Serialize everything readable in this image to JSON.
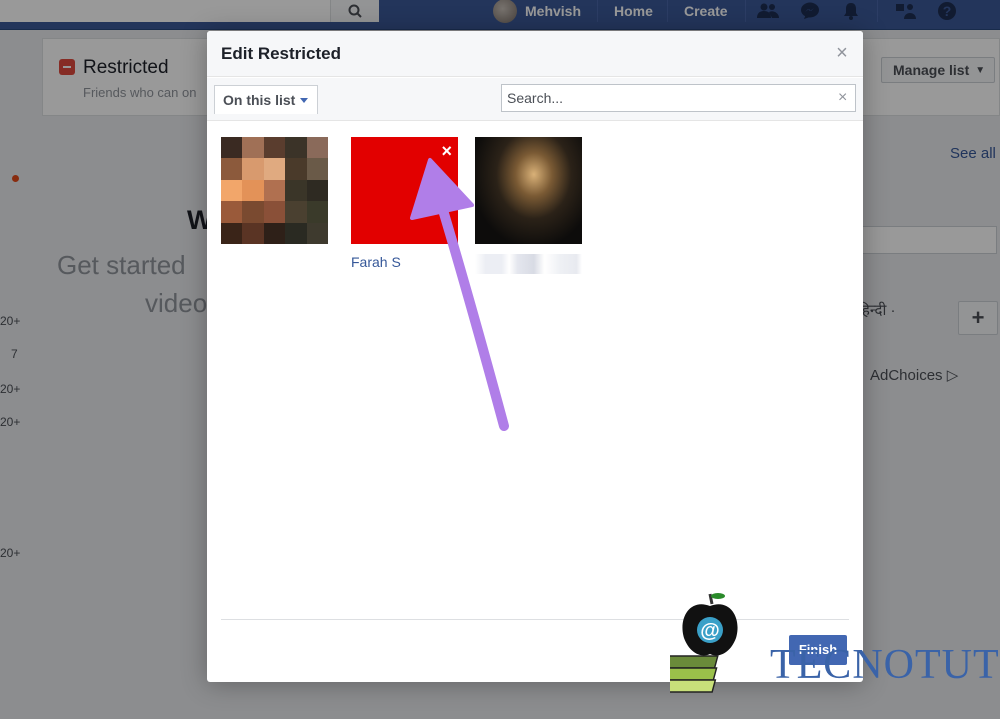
{
  "topbar": {
    "user_name": "Mehvish",
    "home_label": "Home",
    "create_label": "Create",
    "help_icon": "?"
  },
  "background": {
    "title": "Restricted",
    "subtitle": "Friends who can on",
    "manage_list_label": "Manage list",
    "see_all": "See all",
    "language": "हिन्दी ·",
    "add_label": "+",
    "adchoices": "AdChoices",
    "big_heading": "W",
    "get_started": "Get started",
    "video_text": "video",
    "ticks": [
      "20+",
      "7",
      "20+",
      "20+",
      "20+"
    ]
  },
  "dialog": {
    "title": "Edit Restricted",
    "close_icon": "×",
    "filter_label": "On this list",
    "search_placeholder": "Search...",
    "search_clear": "×",
    "friends": [
      {
        "name": "",
        "photo": "pixelated-portrait"
      },
      {
        "name": "Farah S",
        "photo": "red-square",
        "remove_icon": "×"
      },
      {
        "name": "",
        "photo": "night-building"
      }
    ],
    "finish_label": "Finish"
  },
  "watermark": {
    "text": "TECNOTUTO"
  },
  "colors": {
    "fb_blue": "#3b5998",
    "arrow": "#b07ee8",
    "red_photo": "#e20000",
    "button_blue": "#4267b2"
  },
  "icons": [
    "search-icon",
    "friends-icon",
    "messenger-icon",
    "bell-icon",
    "quick-help-icon",
    "help-icon",
    "close-icon",
    "caret-down-icon",
    "remove-icon",
    "plus-icon",
    "adchoices-icon"
  ]
}
